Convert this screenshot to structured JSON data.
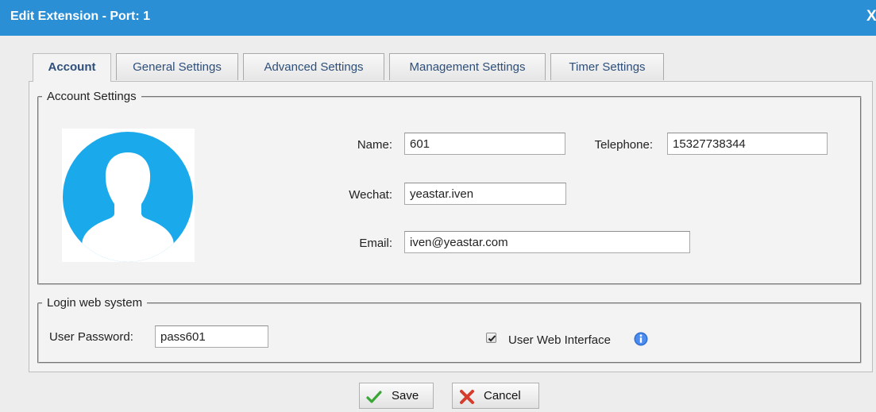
{
  "window": {
    "title": "Edit Extension - Port: 1",
    "close_label": "X"
  },
  "tabs": [
    {
      "label": "Account",
      "active": true
    },
    {
      "label": "General Settings",
      "active": false
    },
    {
      "label": "Advanced Settings",
      "active": false
    },
    {
      "label": "Management Settings",
      "active": false
    },
    {
      "label": "Timer Settings",
      "active": false
    }
  ],
  "account_settings": {
    "legend": "Account Settings",
    "avatar_icon": "user-silhouette-icon",
    "name": {
      "label": "Name:",
      "value": "601"
    },
    "telephone": {
      "label": "Telephone:",
      "value": "15327738344"
    },
    "wechat": {
      "label": "Wechat:",
      "value": "yeastar.iven"
    },
    "email": {
      "label": "Email:",
      "value": "iven@yeastar.com"
    }
  },
  "login_web_system": {
    "legend": "Login web system",
    "password": {
      "label": "User Password:",
      "value": "pass601"
    },
    "user_web_interface": {
      "label": "User Web Interface",
      "checked": true
    }
  },
  "buttons": {
    "save_label": "Save",
    "cancel_label": "Cancel"
  },
  "colors": {
    "title_bar": "#2b8fd6",
    "avatar": "#1aa9ea",
    "tab_text": "#2e4f7a",
    "save_check": "#3aa635",
    "cancel_x": "#d63c2e",
    "info_icon": "#2f6fd1"
  }
}
